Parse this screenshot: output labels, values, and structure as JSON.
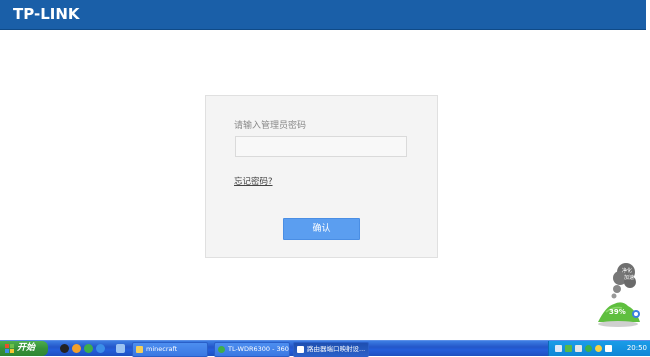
{
  "header": {
    "brand": "TP-LINK"
  },
  "login": {
    "prompt": "请输入管理员密码",
    "password_placeholder": "",
    "forgot_link": "忘记密码?",
    "confirm_button": "确认"
  },
  "widget": {
    "cloud_text_1": "净化",
    "cloud_text_2": "加速",
    "percent": "39%"
  },
  "taskbar": {
    "start_label": "开始",
    "windows": [
      {
        "label": "minecraft"
      },
      {
        "label": "TL-WDR6300 - 360..."
      },
      {
        "label": "路由器端口映射设..."
      }
    ],
    "clock": "20:50"
  },
  "colors": {
    "header_bg": "#1a5fa8",
    "button_bg": "#5b9ef0",
    "taskbar_bg": "#245edb",
    "start_green": "#36913a"
  }
}
